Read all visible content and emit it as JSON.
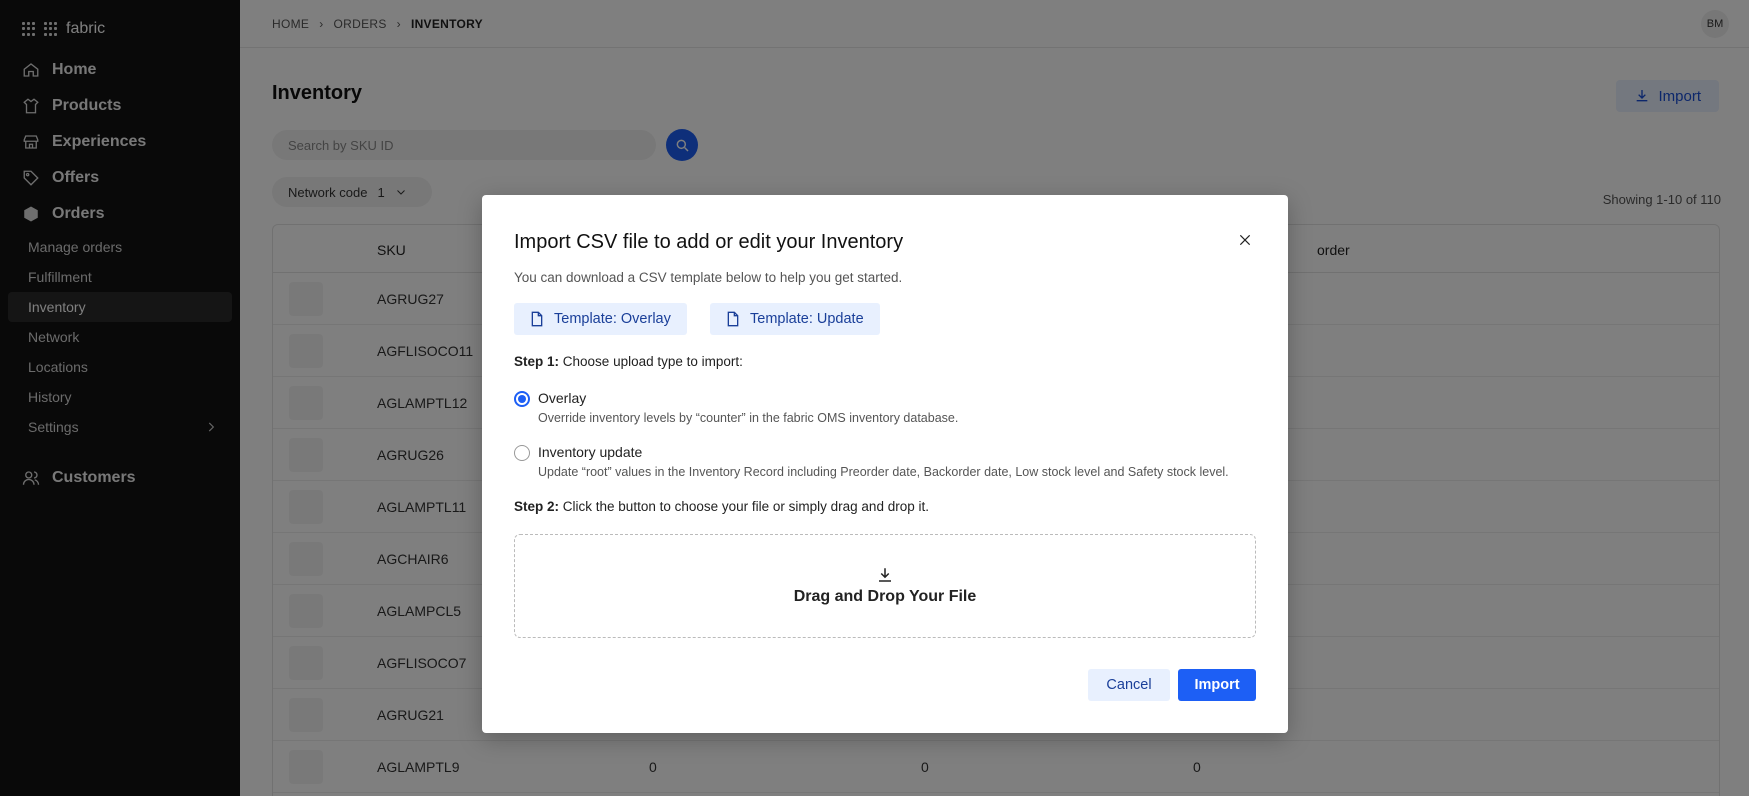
{
  "app": {
    "brand": "fabric"
  },
  "sidebar": {
    "main": [
      {
        "label": "Home",
        "icon": "home-icon"
      },
      {
        "label": "Products",
        "icon": "shirt-icon"
      },
      {
        "label": "Experiences",
        "icon": "store-icon"
      },
      {
        "label": "Offers",
        "icon": "tag-icon"
      },
      {
        "label": "Orders",
        "icon": "box-icon"
      }
    ],
    "sub": [
      "Manage orders",
      "Fulfillment",
      "Inventory",
      "Network",
      "Locations",
      "History",
      "Settings"
    ],
    "customers": "Customers"
  },
  "breadcrumb": [
    "HOME",
    "ORDERS",
    "INVENTORY"
  ],
  "user": {
    "initials": "BM"
  },
  "page": {
    "title": "Inventory",
    "import_label": "Import",
    "search_placeholder": "Search by SKU ID",
    "filter_label": "Network code",
    "filter_count": "1",
    "showing": "Showing 1-10 of 110"
  },
  "table": {
    "headers": [
      "SKU",
      "order"
    ],
    "rows": [
      {
        "sku": "AGRUG27"
      },
      {
        "sku": "AGFLISOCO11"
      },
      {
        "sku": "AGLAMPTL12"
      },
      {
        "sku": "AGRUG26"
      },
      {
        "sku": "AGLAMPTL11"
      },
      {
        "sku": "AGCHAIR6"
      },
      {
        "sku": "AGLAMPCL5"
      },
      {
        "sku": "AGFLISOCO7"
      },
      {
        "sku": "AGRUG21"
      },
      {
        "sku": "AGLAMPTL9",
        "v1": "0",
        "v2": "0",
        "v3": "0"
      }
    ]
  },
  "modal": {
    "title": "Import CSV file to add or edit your Inventory",
    "subtitle": "You can download a CSV template below to help you get started.",
    "template_overlay": "Template: Overlay",
    "template_update": "Template: Update",
    "step1_bold": "Step 1:",
    "step1_text": "Choose upload type to import:",
    "option_overlay_label": "Overlay",
    "option_overlay_desc": "Override inventory levels by “counter” in the fabric OMS inventory database.",
    "option_update_label": "Inventory update",
    "option_update_desc": "Update “root” values in the Inventory Record including Preorder date, Backorder date, Low stock level and Safety stock level.",
    "selected_option": "Overlay",
    "step2_bold": "Step 2:",
    "step2_text": "Click the button to choose your file or simply drag and drop it.",
    "dropzone_text": "Drag and Drop Your File",
    "cancel_label": "Cancel",
    "import_label": "Import"
  },
  "colors": {
    "accent": "#1d5ff5",
    "sidebar_bg": "#121212",
    "light_button_bg": "#e8f0fe"
  }
}
